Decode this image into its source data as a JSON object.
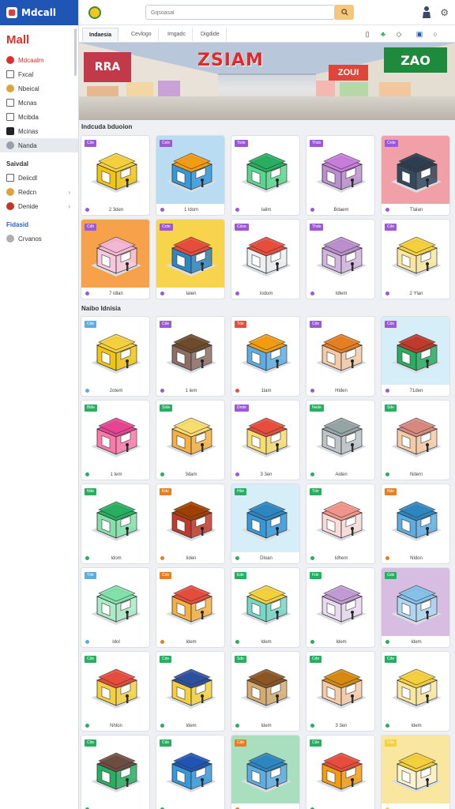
{
  "app": {
    "logo_text": "Mdcall",
    "mall_title": "Mall"
  },
  "sidebar": {
    "items": [
      {
        "label": "Mdcaalm",
        "icon": "red-circle-icon",
        "color": "#d8322e",
        "active": false
      },
      {
        "label": "Fxcal",
        "icon": "square-icon",
        "color": "#666666",
        "active": false
      },
      {
        "label": "Nbeical",
        "icon": "person-icon",
        "color": "#e2a23b",
        "active": false
      },
      {
        "label": "Mcnas",
        "icon": "square-icon",
        "color": "#666666",
        "active": false
      },
      {
        "label": "Mcibda",
        "icon": "square-icon",
        "color": "#666666",
        "active": false
      },
      {
        "label": "Mcinas",
        "icon": "tag-icon",
        "color": "#222222",
        "active": false
      },
      {
        "label": "Nanda",
        "icon": "gray-circle-icon",
        "color": "#9aa0a8",
        "active": true
      }
    ],
    "section2_title": "Saivdal",
    "section2_items": [
      {
        "label": "Deiicdl",
        "icon": "square-icon",
        "color": "#666666"
      },
      {
        "label": "Redcn",
        "icon": "person-icon",
        "color": "#e2a23b"
      },
      {
        "label": "Denide",
        "icon": "person-icon",
        "color": "#c0392b"
      }
    ],
    "section3_title": "Fidasid",
    "section3_items": [
      {
        "label": "Crvanos",
        "icon": "person-icon",
        "color": "#b0b0b0"
      }
    ]
  },
  "topbar": {
    "search_placeholder": "Gqsoasal",
    "search_icon": "search-icon"
  },
  "tabs": [
    "Indaesia",
    "Cevlogo",
    "Imgadc",
    "Digdide"
  ],
  "banner": {
    "title": "ZSIAM",
    "sign_left": "RRA",
    "sign_right": "ZAO",
    "sign_mid": "ZOUI"
  },
  "sections": [
    {
      "title": "Indcuda bduoion",
      "cards": [
        {
          "badge": "Cde",
          "badge_color": "#9b59d6",
          "caption": "2 3den",
          "bg": "#ffffff",
          "roof": "#f4d03f",
          "body": "#f1c40f"
        },
        {
          "badge": "Celn",
          "badge_color": "#9b59d6",
          "caption": "1 ldom",
          "bg": "#b9dcf2",
          "roof": "#f39c12",
          "body": "#3498db"
        },
        {
          "badge": "Tiole",
          "badge_color": "#9b59d6",
          "caption": "Ialim",
          "bg": "#ffffff",
          "roof": "#27ae60",
          "body": "#58d68d"
        },
        {
          "badge": "Thdo",
          "badge_color": "#9b59d6",
          "caption": "Bdaem",
          "bg": "#ffffff",
          "roof": "#c77ddb",
          "body": "#bb8fce"
        },
        {
          "badge": "Crde",
          "badge_color": "#9b59d6",
          "caption": "Tlalan",
          "bg": "#f2a0a8",
          "roof": "#2c3e50",
          "body": "#34495e"
        },
        {
          "badge": "Cdh",
          "badge_color": "#9b59d6",
          "caption": "7 ldlan",
          "bg": "#f7a14a",
          "roof": "#f5b7d3",
          "body": "#f8c8dc"
        },
        {
          "badge": "Crde",
          "badge_color": "#9b59d6",
          "caption": "Ialen",
          "bg": "#f7d44c",
          "roof": "#e74c3c",
          "body": "#2e86c1"
        },
        {
          "badge": "Cdxe",
          "badge_color": "#9b59d6",
          "caption": "Iodom",
          "bg": "#ffffff",
          "roof": "#e74c3c",
          "body": "#ecf0f1"
        },
        {
          "badge": "Thde",
          "badge_color": "#9b59d6",
          "caption": "Idlem",
          "bg": "#ffffff",
          "roof": "#bb8fce",
          "body": "#d2b4de"
        },
        {
          "badge": "Cde",
          "badge_color": "#9b59d6",
          "caption": "2 Ylan",
          "bg": "#ffffff",
          "roof": "#f4d03f",
          "body": "#f9e79f"
        }
      ]
    },
    {
      "title": "Naibo ldnisia",
      "cards": [
        {
          "badge": "Cde",
          "badge_color": "#5dade2",
          "caption": "2otem",
          "bg": "#ffffff",
          "roof": "#f4d03f",
          "body": "#f1c40f"
        },
        {
          "badge": "Cde",
          "badge_color": "#9b59d6",
          "caption": "1 lem",
          "bg": "#ffffff",
          "roof": "#6e4b2a",
          "body": "#8d6e63"
        },
        {
          "badge": "Tde",
          "badge_color": "#e74c3c",
          "caption": "1lam",
          "bg": "#ffffff",
          "roof": "#f39c12",
          "body": "#5dade2"
        },
        {
          "badge": "Cde",
          "badge_color": "#9b59d6",
          "caption": "Hlden",
          "bg": "#ffffff",
          "roof": "#e67e22",
          "body": "#f5cba7"
        },
        {
          "badge": "Cde",
          "badge_color": "#9b59d6",
          "caption": "71den",
          "bg": "#d6eef8",
          "roof": "#c0392b",
          "body": "#27ae60"
        },
        {
          "badge": "Blde",
          "badge_color": "#27ae60",
          "caption": "1 tem",
          "bg": "#ffffff",
          "roof": "#e84393",
          "body": "#fd79a8"
        },
        {
          "badge": "Stde",
          "badge_color": "#27ae60",
          "caption": "3dam",
          "bg": "#ffffff",
          "roof": "#f7dc6f",
          "body": "#f5b041"
        },
        {
          "badge": "Dnde",
          "badge_color": "#9b59d6",
          "caption": "3 3en",
          "bg": "#ffffff",
          "roof": "#e74c3c",
          "body": "#f7dc6f"
        },
        {
          "badge": "Nede",
          "badge_color": "#27ae60",
          "caption": "Aiden",
          "bg": "#ffffff",
          "roof": "#95a5a6",
          "body": "#bdc3c7"
        },
        {
          "badge": "Sde",
          "badge_color": "#27ae60",
          "caption": "Ndem",
          "bg": "#ffffff",
          "roof": "#d98880",
          "body": "#f5cba7"
        },
        {
          "badge": "Nde",
          "badge_color": "#27ae60",
          "caption": "Idom",
          "bg": "#ffffff",
          "roof": "#27ae60",
          "body": "#82e0aa"
        },
        {
          "badge": "Kde",
          "badge_color": "#e67e22",
          "caption": "Iiden",
          "bg": "#ffffff",
          "roof": "#a04000",
          "body": "#c0392b"
        },
        {
          "badge": "Hbe",
          "badge_color": "#27ae60",
          "caption": "Dloan",
          "bg": "#d6eef8",
          "roof": "#2e86c1",
          "body": "#3498db"
        },
        {
          "badge": "Tde",
          "badge_color": "#27ae60",
          "caption": "Idhem",
          "bg": "#ffffff",
          "roof": "#f1948a",
          "body": "#fadbd8"
        },
        {
          "badge": "Nde",
          "badge_color": "#e67e22",
          "caption": "Nldon",
          "bg": "#ffffff",
          "roof": "#2e86c1",
          "body": "#5dade2"
        },
        {
          "badge": "Tde",
          "badge_color": "#5dade2",
          "caption": "Idol",
          "bg": "#ffffff",
          "roof": "#82e0aa",
          "body": "#abebc6"
        },
        {
          "badge": "Cde",
          "badge_color": "#e67e22",
          "caption": "Idem",
          "bg": "#ffffff",
          "roof": "#e74c3c",
          "body": "#f5b041"
        },
        {
          "badge": "Ede",
          "badge_color": "#27ae60",
          "caption": "Idem",
          "bg": "#ffffff",
          "roof": "#f4d03f",
          "body": "#76d7c4"
        },
        {
          "badge": "Fde",
          "badge_color": "#27ae60",
          "caption": "Idem",
          "bg": "#ffffff",
          "roof": "#c39bd3",
          "body": "#e8daef"
        },
        {
          "badge": "Gde",
          "badge_color": "#27ae60",
          "caption": "Idem",
          "bg": "#d7bde2",
          "roof": "#85c1e9",
          "body": "#aed6f1"
        },
        {
          "badge": "Cde",
          "badge_color": "#27ae60",
          "caption": "Nhlon",
          "bg": "#ffffff",
          "roof": "#e74c3c",
          "body": "#f4d03f"
        },
        {
          "badge": "Cde",
          "badge_color": "#27ae60",
          "caption": "Idem",
          "bg": "#ffffff",
          "roof": "#2e4f9e",
          "body": "#f4d03f"
        },
        {
          "badge": "Sde",
          "badge_color": "#27ae60",
          "caption": "Idem",
          "bg": "#ffffff",
          "roof": "#8d5524",
          "body": "#d4ac6e"
        },
        {
          "badge": "Cde",
          "badge_color": "#27ae60",
          "caption": "3 3en",
          "bg": "#ffffff",
          "roof": "#d68910",
          "body": "#f5cba7"
        },
        {
          "badge": "Cde",
          "badge_color": "#27ae60",
          "caption": "Idem",
          "bg": "#ffffff",
          "roof": "#f4d03f",
          "body": "#f9e79f"
        },
        {
          "badge": "Cde",
          "badge_color": "#27ae60",
          "caption": "",
          "bg": "#ffffff",
          "roof": "#6d4c41",
          "body": "#27ae60"
        },
        {
          "badge": "Cde",
          "badge_color": "#27ae60",
          "caption": "",
          "bg": "#ffffff",
          "roof": "#1f56b5",
          "body": "#3498db"
        },
        {
          "badge": "Cde",
          "badge_color": "#e67e22",
          "caption": "",
          "bg": "#a9dfbf",
          "roof": "#2e86c1",
          "body": "#5dade2"
        },
        {
          "badge": "Cde",
          "badge_color": "#27ae60",
          "caption": "",
          "bg": "#ffffff",
          "roof": "#e74c3c",
          "body": "#f39c12"
        },
        {
          "badge": "Cde",
          "badge_color": "#f4d03f",
          "caption": "",
          "bg": "#f9e79f",
          "roof": "#f4d03f",
          "body": "#fcf3cf"
        }
      ]
    }
  ]
}
